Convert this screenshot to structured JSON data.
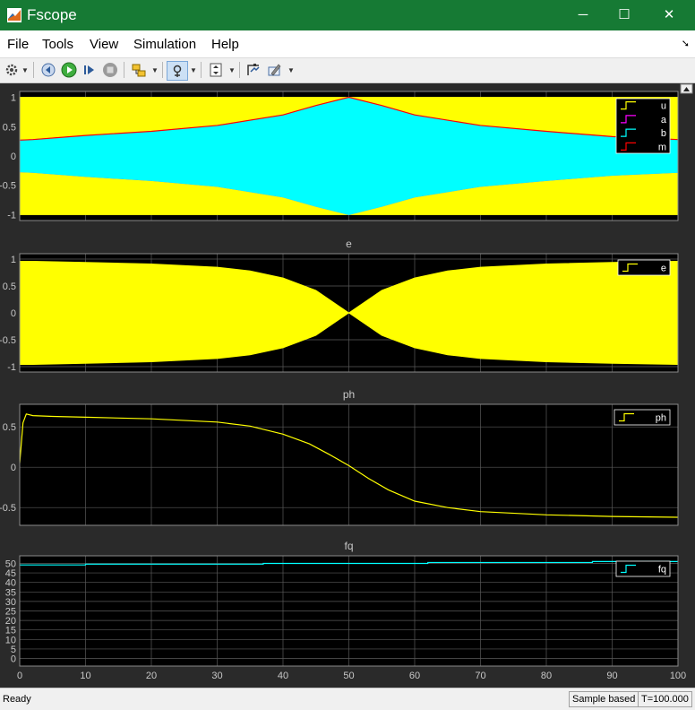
{
  "window": {
    "title": "Fscope",
    "controls": {
      "minimize": "─",
      "maximize": "☐",
      "close": "✕"
    }
  },
  "menu": {
    "items": [
      "File",
      "Tools",
      "View",
      "Simulation",
      "Help"
    ]
  },
  "toolbar": {
    "icons": [
      "gear-icon",
      "step-back-icon",
      "run-icon",
      "step-forward-icon",
      "stop-icon",
      "highlight-block-icon",
      "zoom-icon",
      "autoscale-icon",
      "cursor-measure-icon",
      "signal-statistics-icon"
    ]
  },
  "status": {
    "left": "Ready",
    "mode": "Sample based",
    "time": "T=100.000"
  },
  "colors": {
    "u": "#ffff00",
    "a": "#ff00ff",
    "b": "#00ffff",
    "m": "#ff0000",
    "e": "#ffff00",
    "ph": "#ffff00",
    "fq": "#00ffff",
    "axes_bg": "#000000",
    "figure_bg": "#2a2a2a",
    "grid": "#5a5a5a"
  },
  "chart_data": [
    {
      "type": "line",
      "title": "",
      "xlim": [
        0,
        100
      ],
      "ylim": [
        -1.1,
        1.1
      ],
      "yticks": [
        -1,
        -0.5,
        0,
        0.5,
        1
      ],
      "ytick_labels": [
        "-1",
        "-0.5",
        "0",
        "0.5",
        "1"
      ],
      "xticks": [
        0,
        10,
        20,
        30,
        40,
        50,
        60,
        70,
        80,
        90,
        100
      ],
      "grid": true,
      "legend": "top-right",
      "series": [
        {
          "name": "u",
          "kind": "band",
          "x": [
            0,
            100
          ],
          "upper": [
            1,
            1
          ],
          "lower": [
            -1,
            -1
          ]
        },
        {
          "name": "a",
          "kind": "band",
          "x": [
            0,
            2,
            10,
            20,
            30,
            40,
            45,
            50,
            55,
            60,
            70,
            80,
            90,
            100
          ],
          "upper": [
            0.27,
            0.28,
            0.35,
            0.42,
            0.52,
            0.7,
            0.86,
            1.0,
            0.86,
            0.7,
            0.52,
            0.42,
            0.33,
            0.28
          ],
          "lower": [
            -0.27,
            -0.28,
            -0.35,
            -0.42,
            -0.52,
            -0.7,
            -0.86,
            -1.0,
            -0.86,
            -0.7,
            -0.52,
            -0.42,
            -0.33,
            -0.28
          ]
        },
        {
          "name": "b",
          "kind": "band",
          "x": [
            0,
            2,
            10,
            20,
            30,
            40,
            45,
            50,
            55,
            60,
            70,
            80,
            90,
            100
          ],
          "upper": [
            0.27,
            0.28,
            0.35,
            0.42,
            0.52,
            0.7,
            0.86,
            1.0,
            0.86,
            0.7,
            0.52,
            0.42,
            0.33,
            0.28
          ],
          "lower": [
            -0.27,
            -0.28,
            -0.35,
            -0.42,
            -0.52,
            -0.7,
            -0.86,
            -1.0,
            -0.86,
            -0.7,
            -0.52,
            -0.42,
            -0.33,
            -0.28
          ]
        },
        {
          "name": "m",
          "kind": "line",
          "x": [
            0,
            2,
            10,
            20,
            30,
            40,
            45,
            50,
            55,
            60,
            70,
            80,
            90,
            100
          ],
          "y": [
            0.27,
            0.28,
            0.35,
            0.42,
            0.52,
            0.7,
            0.86,
            1.0,
            0.86,
            0.7,
            0.52,
            0.42,
            0.33,
            0.28
          ]
        }
      ]
    },
    {
      "type": "line",
      "title": "e",
      "xlim": [
        0,
        100
      ],
      "ylim": [
        -1.1,
        1.1
      ],
      "yticks": [
        -1,
        -0.5,
        0,
        0.5,
        1
      ],
      "ytick_labels": [
        "-1",
        "-0.5",
        "0",
        "0.5",
        "1"
      ],
      "xticks": [
        0,
        10,
        20,
        30,
        40,
        50,
        60,
        70,
        80,
        90,
        100
      ],
      "grid": true,
      "legend": "top-right",
      "series": [
        {
          "name": "e",
          "kind": "band",
          "x": [
            0,
            2,
            10,
            20,
            30,
            35,
            40,
            45,
            50,
            55,
            60,
            65,
            70,
            80,
            90,
            100
          ],
          "upper": [
            0.96,
            0.96,
            0.94,
            0.91,
            0.85,
            0.78,
            0.65,
            0.42,
            0.0,
            0.42,
            0.65,
            0.78,
            0.85,
            0.91,
            0.94,
            0.96
          ],
          "lower": [
            -0.96,
            -0.96,
            -0.94,
            -0.91,
            -0.85,
            -0.78,
            -0.65,
            -0.42,
            0.0,
            -0.42,
            -0.65,
            -0.78,
            -0.85,
            -0.91,
            -0.94,
            -0.96
          ]
        }
      ]
    },
    {
      "type": "line",
      "title": "ph",
      "xlim": [
        0,
        100
      ],
      "ylim": [
        -0.72,
        0.78
      ],
      "yticks": [
        -0.5,
        0,
        0.5
      ],
      "ytick_labels": [
        "-0.5",
        "0",
        "0.5"
      ],
      "xticks": [
        0,
        10,
        20,
        30,
        40,
        50,
        60,
        70,
        80,
        90,
        100
      ],
      "grid": true,
      "legend": "top-right",
      "series": [
        {
          "name": "ph",
          "kind": "line",
          "x": [
            0,
            0.5,
            1,
            2,
            5,
            10,
            20,
            30,
            35,
            40,
            44,
            47,
            50,
            53,
            56,
            60,
            65,
            70,
            80,
            90,
            100
          ],
          "y": [
            0.05,
            0.55,
            0.66,
            0.64,
            0.63,
            0.62,
            0.6,
            0.56,
            0.51,
            0.41,
            0.29,
            0.16,
            0.02,
            -0.14,
            -0.28,
            -0.42,
            -0.5,
            -0.55,
            -0.59,
            -0.61,
            -0.62
          ]
        }
      ]
    },
    {
      "type": "line",
      "title": "fq",
      "xlim": [
        0,
        100
      ],
      "ylim": [
        -4,
        54
      ],
      "yticks": [
        0,
        5,
        10,
        15,
        20,
        25,
        30,
        35,
        40,
        45,
        50
      ],
      "ytick_labels": [
        "0",
        "5",
        "10",
        "15",
        "20",
        "25",
        "30",
        "35",
        "40",
        "45",
        "50"
      ],
      "xticks": [
        0,
        10,
        20,
        30,
        40,
        50,
        60,
        70,
        80,
        90,
        100
      ],
      "xtick_labels": [
        "0",
        "10",
        "20",
        "30",
        "40",
        "50",
        "60",
        "70",
        "80",
        "90",
        "100"
      ],
      "grid": true,
      "legend": "top-right",
      "series": [
        {
          "name": "fq",
          "kind": "step",
          "x": [
            0,
            10,
            10,
            37,
            37,
            62,
            62,
            87,
            87,
            100
          ],
          "y": [
            49.2,
            49.2,
            49.6,
            49.6,
            50.0,
            50.0,
            50.5,
            50.5,
            51.0,
            51.0
          ]
        }
      ]
    }
  ]
}
